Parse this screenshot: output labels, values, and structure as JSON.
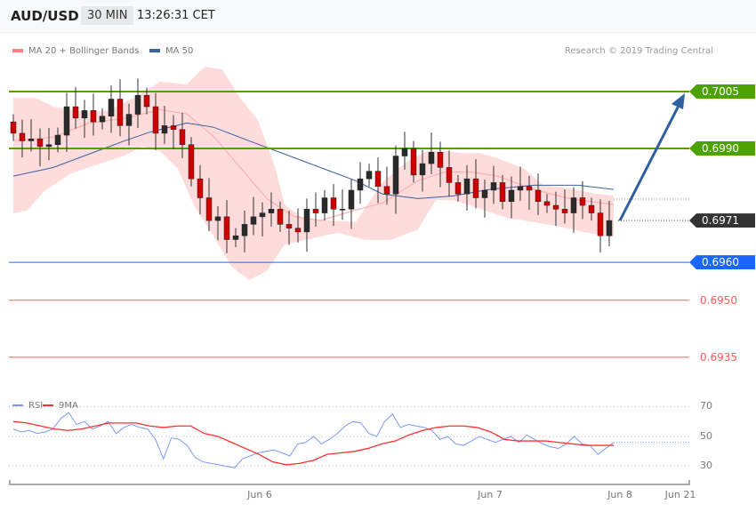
{
  "header": {
    "symbol": "AUD/USD",
    "timeframe": "30 MIN",
    "time": "13:26:31 CET"
  },
  "legend": {
    "ma20": "MA 20 + Bollinger Bands",
    "ma50": "MA 50",
    "copyright": "Research © 2019 Trading Central"
  },
  "colors": {
    "green": "#4ca300",
    "blue": "#1a66ff",
    "dark": "#333333",
    "red": "#ff5a5a",
    "band": "#fdd0d0",
    "ma50": "#3a62a0",
    "arrow": "#2e5fa0",
    "rsi": "#7a9af0",
    "rsi_ma": "#ff3030"
  },
  "levels": [
    {
      "label": "0.7005",
      "price": 0.7005,
      "type": "resistance",
      "color": "#4ca300"
    },
    {
      "label": "0.6990",
      "price": 0.699,
      "type": "resistance",
      "color": "#4ca300"
    },
    {
      "label": "0.6971",
      "price": 0.6971,
      "type": "current",
      "color": "#333333"
    },
    {
      "label": "0.6960",
      "price": 0.696,
      "type": "pivot",
      "color": "#1a66ff"
    },
    {
      "label": "0.6950",
      "price": 0.695,
      "type": "support",
      "color": "#ff5a5a"
    },
    {
      "label": "0.6935",
      "price": 0.6935,
      "type": "support",
      "color": "#ff5a5a"
    }
  ],
  "chart_data": [
    {
      "type": "candlestick",
      "title": "AUD/USD 30 MIN",
      "ylim": [
        0.693,
        0.702
      ],
      "closes": [
        0.6994,
        0.6992,
        0.69925,
        0.69905,
        0.6991,
        0.69935,
        0.7001,
        0.6998,
        0.7,
        0.6997,
        0.69985,
        0.7003,
        0.6996,
        0.6999,
        0.7004,
        0.7001,
        0.6994,
        0.6996,
        0.6995,
        0.6991,
        0.6982,
        0.6977,
        0.6971,
        0.6972,
        0.6966,
        0.6967,
        0.697,
        0.6972,
        0.6973,
        0.6974,
        0.697,
        0.6969,
        0.6968,
        0.6974,
        0.6973,
        0.6977,
        0.6974,
        0.6974,
        0.6979,
        0.6982,
        0.6984,
        0.698,
        0.6978,
        0.6988,
        0.699,
        0.6983,
        0.6986,
        0.6989,
        0.6985,
        0.6981,
        0.6978,
        0.6982,
        0.6977,
        0.6979,
        0.6981,
        0.6976,
        0.6979,
        0.698,
        0.6979,
        0.6976,
        0.6975,
        0.6974,
        0.6973,
        0.6977,
        0.6975,
        0.6973,
        0.6967,
        0.6971
      ],
      "bollinger_upper": [
        [
          0,
          0.70033
        ],
        [
          2.5,
          0.70033
        ],
        [
          4.5,
          0.7001
        ],
        [
          7.5,
          0.69998
        ],
        [
          10.5,
          0.69998
        ],
        [
          13.5,
          0.70033
        ],
        [
          16.5,
          0.70076
        ],
        [
          19.5,
          0.70069
        ],
        [
          21.5,
          0.70115
        ],
        [
          23.5,
          0.70108
        ],
        [
          25.5,
          0.70033
        ],
        [
          27.5,
          0.69975
        ],
        [
          29.5,
          0.69846
        ],
        [
          30.5,
          0.69752
        ],
        [
          32.5,
          0.69717
        ],
        [
          35.5,
          0.6971
        ],
        [
          38.5,
          0.69706
        ],
        [
          41.5,
          0.69811
        ],
        [
          44.5,
          0.6987
        ],
        [
          46.5,
          0.69893
        ],
        [
          48.5,
          0.69893
        ],
        [
          50.5,
          0.69888
        ],
        [
          52.5,
          0.69888
        ],
        [
          54.5,
          0.69874
        ],
        [
          57.5,
          0.69846
        ],
        [
          59.5,
          0.69804
        ],
        [
          62.5,
          0.69795
        ],
        [
          65.5,
          0.69781
        ],
        [
          67.5,
          0.69776
        ]
      ],
      "bollinger_lower": [
        [
          0,
          0.69729
        ],
        [
          1.5,
          0.69736
        ],
        [
          3.5,
          0.69788
        ],
        [
          6.5,
          0.69834
        ],
        [
          9.5,
          0.69858
        ],
        [
          12.5,
          0.69881
        ],
        [
          14.5,
          0.69905
        ],
        [
          16.5,
          0.69893
        ],
        [
          18.5,
          0.69846
        ],
        [
          20.5,
          0.69741
        ],
        [
          22.5,
          0.6967
        ],
        [
          24.5,
          0.69589
        ],
        [
          26.5,
          0.69553
        ],
        [
          28.5,
          0.69577
        ],
        [
          30.5,
          0.69647
        ],
        [
          33.5,
          0.69663
        ],
        [
          36.5,
          0.69678
        ],
        [
          39.5,
          0.69659
        ],
        [
          42.5,
          0.69659
        ],
        [
          45.5,
          0.69687
        ],
        [
          47.5,
          0.69764
        ],
        [
          49.5,
          0.69764
        ],
        [
          52.5,
          0.69741
        ],
        [
          55.5,
          0.69717
        ],
        [
          58.5,
          0.69706
        ],
        [
          61.5,
          0.69694
        ],
        [
          64.5,
          0.69678
        ],
        [
          67.5,
          0.69666
        ]
      ],
      "ma20": [
        [
          0,
          0.6992
        ],
        [
          4.5,
          0.6993
        ],
        [
          8.5,
          0.69967
        ],
        [
          12.5,
          0.69979
        ],
        [
          16.5,
          0.70002
        ],
        [
          19.5,
          0.69991
        ],
        [
          22.5,
          0.69932
        ],
        [
          25.5,
          0.6985
        ],
        [
          28.5,
          0.69768
        ],
        [
          31.5,
          0.69721
        ],
        [
          34.5,
          0.6971
        ],
        [
          38.5,
          0.69738
        ],
        [
          41.5,
          0.69756
        ],
        [
          45.5,
          0.69815
        ],
        [
          48.5,
          0.69838
        ],
        [
          51.5,
          0.69838
        ],
        [
          54.5,
          0.69827
        ],
        [
          58.5,
          0.69792
        ],
        [
          62.5,
          0.69768
        ],
        [
          67.5,
          0.69752
        ]
      ],
      "ma50": [
        [
          0,
          0.69827
        ],
        [
          4.5,
          0.6985
        ],
        [
          8.5,
          0.69885
        ],
        [
          12.5,
          0.6992
        ],
        [
          15.5,
          0.69944
        ],
        [
          19.5,
          0.69967
        ],
        [
          22.5,
          0.69956
        ],
        [
          26.5,
          0.6992
        ],
        [
          30.5,
          0.69885
        ],
        [
          34.5,
          0.6985
        ],
        [
          38.5,
          0.69815
        ],
        [
          41.5,
          0.6978
        ],
        [
          45.5,
          0.69768
        ],
        [
          49.5,
          0.69775
        ],
        [
          53.5,
          0.69792
        ],
        [
          58.5,
          0.69803
        ],
        [
          63.5,
          0.69803
        ],
        [
          67.5,
          0.69792
        ]
      ],
      "forecast_target": 0.7005
    },
    {
      "type": "line",
      "title": "RSI",
      "legend": [
        "RSI",
        "9MA"
      ],
      "yticks": [
        "70",
        "50",
        "30"
      ],
      "ylim": [
        20,
        80
      ],
      "xticks": [
        "Jun 6",
        "Jun 7",
        "Jun 8",
        "Jun 21"
      ],
      "rsi": [
        55,
        53,
        54,
        52,
        53,
        55,
        62,
        66,
        58,
        60,
        55,
        57,
        60,
        52,
        56,
        58,
        56,
        55,
        48,
        35,
        49,
        48,
        44,
        36,
        33,
        32,
        31,
        30,
        29,
        35,
        37,
        39,
        40,
        41,
        39,
        37,
        45,
        46,
        50,
        45,
        48,
        52,
        57,
        60,
        59,
        52,
        50,
        60,
        65,
        56,
        58,
        57,
        56,
        54,
        48,
        50,
        45,
        44,
        47,
        50,
        48,
        46,
        48,
        50,
        46,
        51,
        48,
        45,
        43,
        42,
        45,
        50,
        45,
        44,
        38,
        42,
        46
      ],
      "ma9": [
        60,
        59,
        57,
        55,
        54,
        55,
        57,
        59,
        59,
        59,
        57,
        56,
        57,
        57,
        52,
        50,
        46,
        42,
        38,
        33,
        31,
        32,
        34,
        38,
        39,
        40,
        42,
        45,
        47,
        51,
        54,
        56,
        57,
        57,
        56,
        53,
        48,
        47,
        47,
        47,
        46,
        45,
        44,
        44,
        44
      ]
    }
  ]
}
